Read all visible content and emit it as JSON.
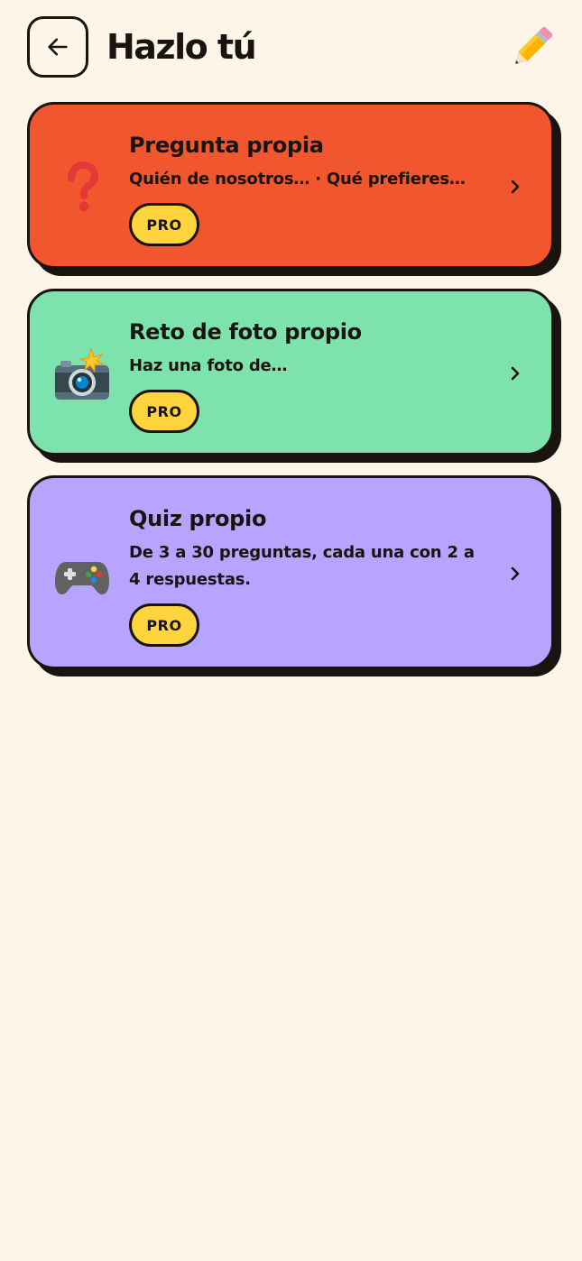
{
  "header": {
    "title": "Hazlo tú",
    "back_icon": "arrow-left-icon",
    "pencil_icon": "pencil-icon"
  },
  "cards": [
    {
      "title": "Pregunta propia",
      "subtitle": "Quién de nosotros… · Qué prefieres…",
      "badge": "PRO",
      "icon": "question-mark-icon",
      "color": "#F2562F"
    },
    {
      "title": "Reto de foto propio",
      "subtitle": "Haz una foto de…",
      "badge": "PRO",
      "icon": "camera-flash-icon",
      "color": "#7DE2AB"
    },
    {
      "title": "Quiz propio",
      "subtitle": "De 3 a 30 preguntas, cada una con 2 a 4 respuestas.",
      "badge": "PRO",
      "icon": "game-controller-icon",
      "color": "#B7A4FE"
    }
  ],
  "colors": {
    "background": "#FEF5E9",
    "ink": "#1A1410",
    "badge": "#FFD43D"
  }
}
